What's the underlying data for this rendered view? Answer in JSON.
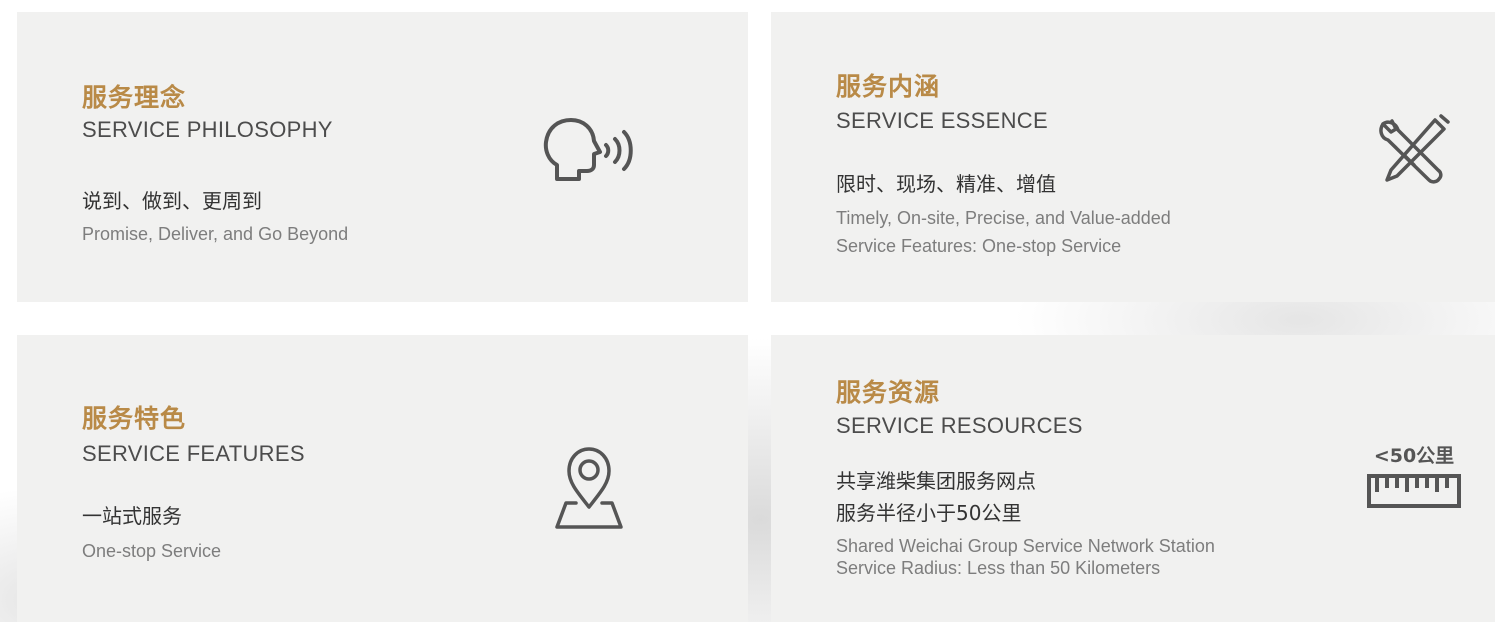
{
  "cards": [
    {
      "title_cn": "服务理念",
      "title_en": "SERVICE PHILOSOPHY",
      "desc_cn": [
        "说到、做到、更周到"
      ],
      "desc_en": [
        "Promise, Deliver, and Go Beyond"
      ],
      "icon": "speaking-head-icon"
    },
    {
      "title_cn": "服务内涵",
      "title_en": "SERVICE ESSENCE",
      "desc_cn": [
        "限时、现场、精准、增值"
      ],
      "desc_en": [
        "Timely, On-site, Precise, and Value-added",
        "Service Features: One-stop Service"
      ],
      "icon": "wrench-screwdriver-icon"
    },
    {
      "title_cn": "服务特色",
      "title_en": "SERVICE FEATURES",
      "desc_cn": [
        "一站式服务"
      ],
      "desc_en": [
        "One-stop Service"
      ],
      "icon": "map-pin-icon"
    },
    {
      "title_cn": "服务资源",
      "title_en": "SERVICE RESOURCES",
      "desc_cn": [
        "共享潍柴集团服务网点",
        "服务半径小于50公里"
      ],
      "desc_en": [
        "Shared Weichai Group Service Network Station",
        "Service Radius: Less than 50 Kilometers"
      ],
      "icon": "ruler-icon",
      "icon_label": "<50公里"
    }
  ],
  "colors": {
    "accent": "#b98a47",
    "card_bg": "#f1f1f0",
    "heading": "#4c4c4c",
    "subtext": "#7d7d7d",
    "icon": "#555555"
  }
}
